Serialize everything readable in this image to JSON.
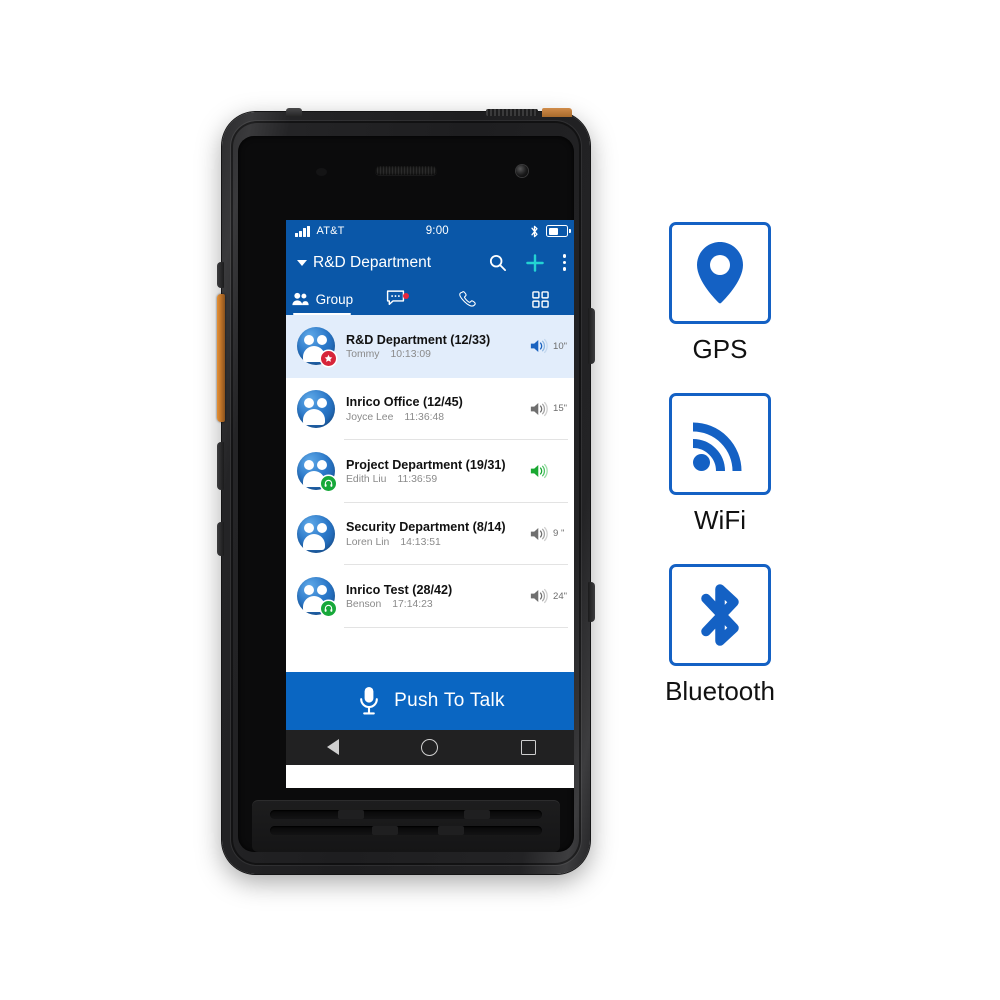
{
  "device": {
    "name": "rugged-ptt-smartphone"
  },
  "screen": {
    "status_bar": {
      "carrier": "AT&T",
      "time": "9:00",
      "signal_icon": "signal-bars-icon",
      "bluetooth_icon": "bluetooth-icon",
      "battery_icon": "battery-icon"
    },
    "app_bar": {
      "title": "R&D Department",
      "dropdown_icon": "caret-down-icon",
      "search_icon": "search-icon",
      "add_icon": "plus-icon",
      "add_color": "#23d3d3",
      "overflow_icon": "kebab-menu-icon",
      "background": "#0a57a8"
    },
    "tabs": [
      {
        "label": "Group",
        "icon": "group-people-icon",
        "active": true,
        "badge": false
      },
      {
        "label": "",
        "icon": "chat-bubble-icon",
        "active": false,
        "badge": true
      },
      {
        "label": "",
        "icon": "phone-handset-icon",
        "active": false,
        "badge": false
      },
      {
        "label": "",
        "icon": "grid-apps-icon",
        "active": false,
        "badge": false
      }
    ],
    "group_list": [
      {
        "name": "R&D Department (12/33)",
        "speaker": "Tommy",
        "time": "10:13:09",
        "duration": "10\"",
        "speaker_icon": "speaker-volume-icon",
        "speaker_color": "#1a63c0",
        "badge": "star-badge",
        "selected": true
      },
      {
        "name": "Inrico Office (12/45)",
        "speaker": "Joyce Lee",
        "time": "11:36:48",
        "duration": "15\"",
        "speaker_icon": "speaker-volume-icon",
        "speaker_color": "#6f6f6f",
        "badge": "none",
        "selected": false
      },
      {
        "name": "Project Department (19/31)",
        "speaker": "Edith Liu",
        "time": "11:36:59",
        "duration": "",
        "speaker_icon": "speaker-volume-icon",
        "speaker_color": "#1aa832",
        "badge": "headset-badge",
        "selected": false
      },
      {
        "name": "Security Department (8/14)",
        "speaker": "Loren Lin",
        "time": "14:13:51",
        "duration": "9 \"",
        "speaker_icon": "speaker-volume-icon",
        "speaker_color": "#6f6f6f",
        "badge": "none",
        "selected": false
      },
      {
        "name": "Inrico Test (28/42)",
        "speaker": "Benson",
        "time": "17:14:23",
        "duration": "24\"",
        "speaker_icon": "speaker-volume-icon",
        "speaker_color": "#6f6f6f",
        "badge": "headset-badge",
        "selected": false
      }
    ],
    "ptt_button": {
      "label": "Push To Talk",
      "icon": "microphone-icon",
      "background": "#0a66c2"
    },
    "nav_bar": {
      "back_icon": "back-triangle-icon",
      "home_icon": "home-circle-icon",
      "recents_icon": "recents-square-icon"
    }
  },
  "features": [
    {
      "label": "GPS",
      "icon": "map-pin-icon",
      "color": "#1461c4"
    },
    {
      "label": "WiFi",
      "icon": "wifi-signal-icon",
      "color": "#1461c4"
    },
    {
      "label": "Bluetooth",
      "icon": "bluetooth-icon",
      "color": "#1461c4"
    }
  ]
}
